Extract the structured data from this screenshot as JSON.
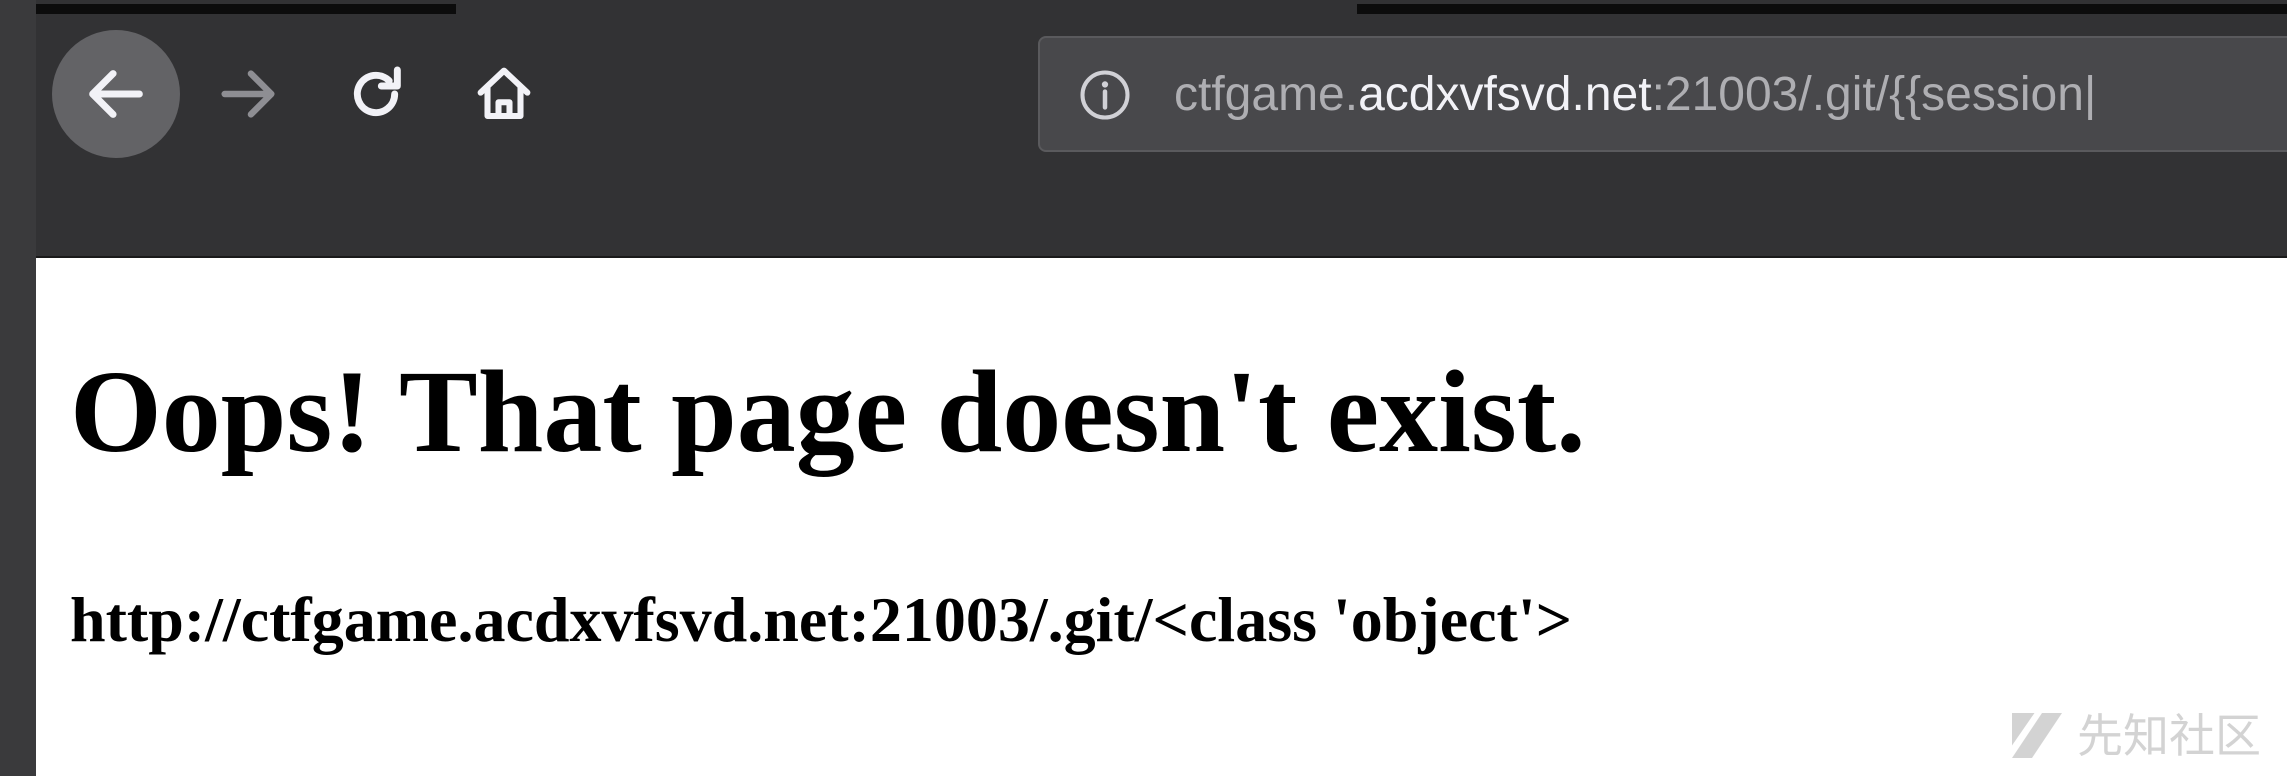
{
  "browser": {
    "url": {
      "prefix": "ctfgame.",
      "domain": "acdxvfsvd.net",
      "suffix": ":21003/.git/{{session|"
    },
    "icons": {
      "back": "arrow-left-icon",
      "forward": "arrow-right-icon",
      "reload": "reload-icon",
      "home": "home-icon",
      "info": "info-icon"
    }
  },
  "page": {
    "heading": "Oops! That page doesn't exist.",
    "url_line": "http://ctfgame.acdxvfsvd.net:21003/.git/<class 'object'>"
  },
  "watermark": {
    "text": "先知社区"
  },
  "colors": {
    "chrome_bg": "#323234",
    "urlbar_bg": "#48484b",
    "back_btn_bg": "#636366",
    "url_domain": "#f2f2f7",
    "url_dim": "#aeaeb2"
  }
}
